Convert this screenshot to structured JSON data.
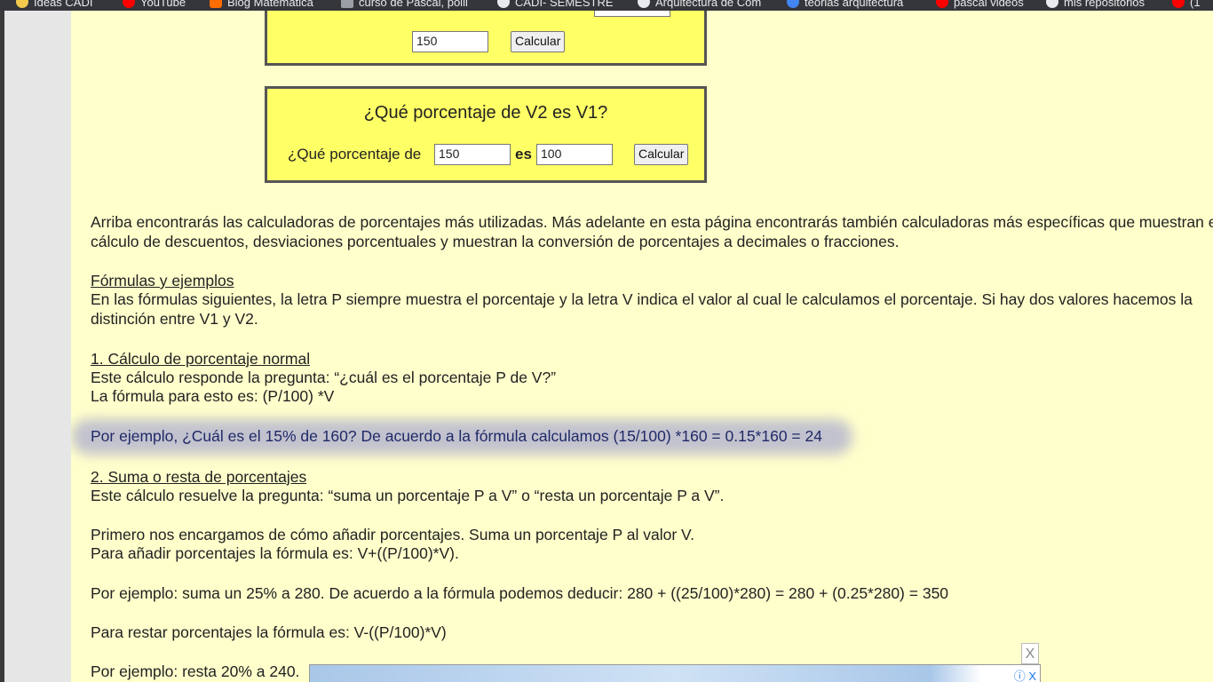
{
  "bookmarks": [
    {
      "label": "Ideas CADI",
      "color": "#f2c94c"
    },
    {
      "label": "YouTube",
      "color": "#ff0000"
    },
    {
      "label": "Blog Matemática",
      "color": "#ff6d00"
    },
    {
      "label": "curso de Pascal, polli",
      "color": "#9aa0a6"
    },
    {
      "label": "CADI- SEMESTRE",
      "color": "#e8eaed"
    },
    {
      "label": "Arquitectura de Com",
      "color": "#e8eaed"
    },
    {
      "label": "teorias arquitectura",
      "color": "#4285f4"
    },
    {
      "label": "pascal videos",
      "color": "#ff0000"
    },
    {
      "label": "mis repositorios",
      "color": "#e8eaed"
    },
    {
      "label": "(1",
      "color": "#ff0000"
    }
  ],
  "calc1": {
    "value": "150",
    "button": "Calcular"
  },
  "calc2": {
    "title": "¿Qué porcentaje de V2 es V1?",
    "label": "¿Qué porcentaje de",
    "value1": "150",
    "connector": "es",
    "value2": "100",
    "button": "Calcular"
  },
  "content": {
    "intro1": "Arriba encontrarás las calculadoras de porcentajes más utilizadas. Más adelante en esta página encontrarás también calculadoras más específicas que muestran el",
    "intro2": "cálculo de descuentos, desviaciones porcentuales y muestran la conversión de porcentajes a decimales o fracciones.",
    "formulas_heading": "Fórmulas y ejemplos",
    "formulas1": "En las fórmulas siguientes, la letra P siempre muestra el porcentaje y la letra V indica el valor al cual le calculamos el porcentaje. Si hay dos valores hacemos la",
    "formulas2": "distinción entre V1 y V2.",
    "s1_heading": "1. Cálculo de porcentaje normal",
    "s1_line1": "Este cálculo responde la pregunta: “¿cuál es el porcentaje P de V?”",
    "s1_line2": "La fórmula para esto es: (P/100) *V",
    "s1_example": "Por ejemplo, ¿Cuál es el 15% de 160? De acuerdo a la fórmula calculamos (15/100) *160 = 0.15*160 = 24",
    "s2_heading": "2. Suma o resta de porcentajes",
    "s2_line1": "Este cálculo resuelve la pregunta: “suma un porcentaje P a V” o “resta un porcentaje P a V”.",
    "s2_p1": "Primero nos encargamos de cómo añadir porcentajes. Suma un porcentaje P al valor V.",
    "s2_p2": "Para añadir porcentajes la fórmula es: V+((P/100)*V).",
    "s2_example1": "Por ejemplo: suma un 25% a 280. De acuerdo a la fórmula podemos deducir: 280 + ((25/100)*280) = 280 + (0.25*280) = 350",
    "s2_sub": "Para restar porcentajes la fórmula es: V-((P/100)*V)",
    "s2_example2": "Por ejemplo: resta 20% a 240."
  },
  "ad": {
    "close": "X",
    "icons": "ⓘ X"
  }
}
